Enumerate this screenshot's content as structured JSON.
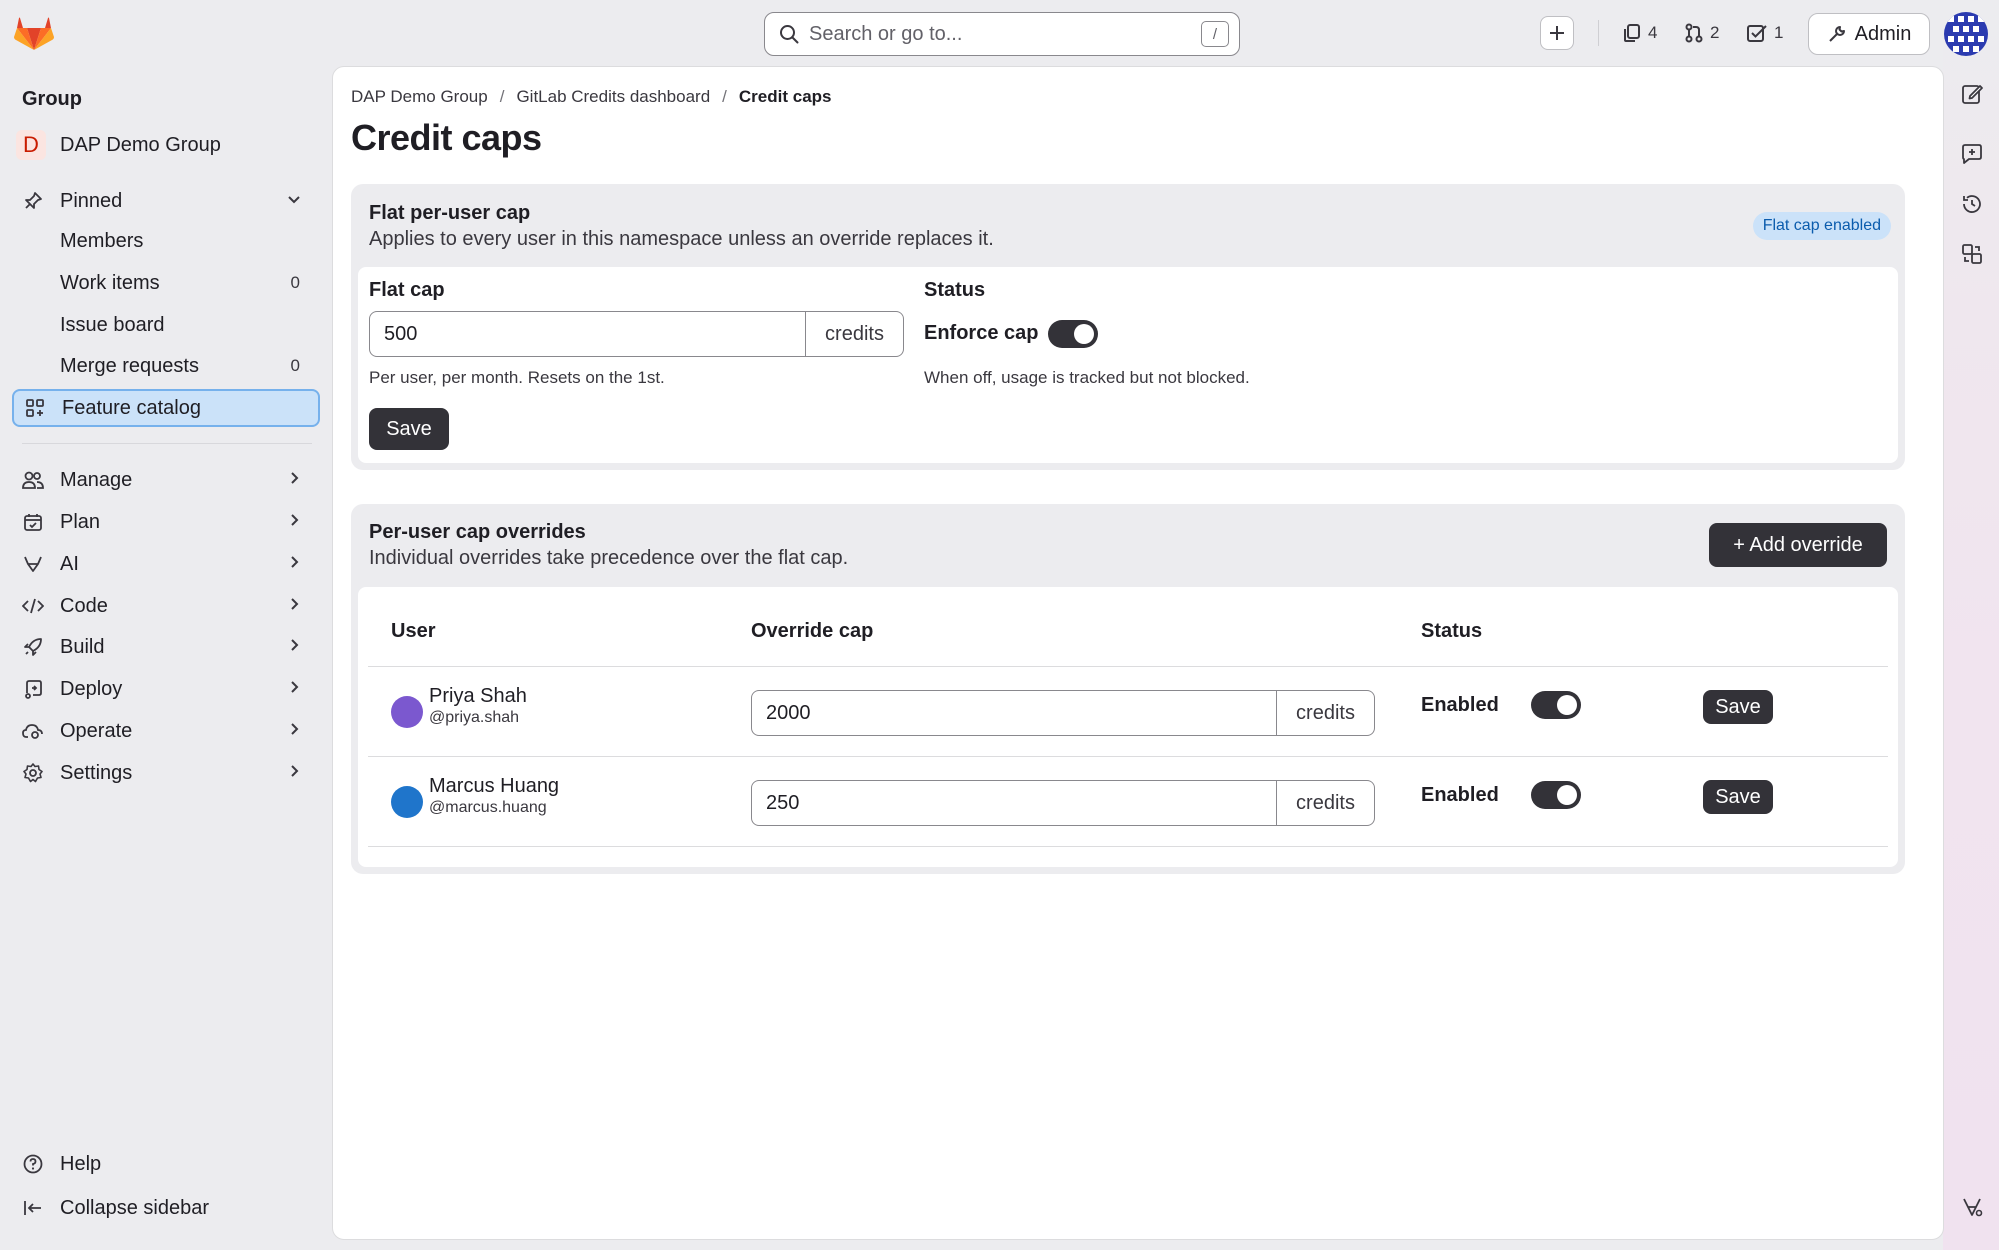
{
  "search": {
    "placeholder": "Search or go to...",
    "shortcut": "/"
  },
  "topbar": {
    "counters": [
      {
        "icon": "issues-icon",
        "value": "4"
      },
      {
        "icon": "merge-request-icon",
        "value": "2"
      },
      {
        "icon": "todo-icon",
        "value": "1"
      }
    ],
    "admin_label": "Admin"
  },
  "sidebar": {
    "heading": "Group",
    "group_initial": "D",
    "group_name": "DAP Demo Group",
    "pinned_label": "Pinned",
    "pinned_items": [
      {
        "label": "Members",
        "count": ""
      },
      {
        "label": "Work items",
        "count": "0"
      },
      {
        "label": "Issue board",
        "count": ""
      },
      {
        "label": "Merge requests",
        "count": "0"
      }
    ],
    "active_item": "Feature catalog",
    "sections": [
      "Manage",
      "Plan",
      "AI",
      "Code",
      "Build",
      "Deploy",
      "Operate",
      "Settings"
    ],
    "help_label": "Help",
    "collapse_label": "Collapse sidebar"
  },
  "breadcrumbs": [
    "DAP Demo Group",
    "GitLab Credits dashboard",
    "Credit caps"
  ],
  "page_title": "Credit caps",
  "flat_cap_card": {
    "title": "Flat per-user cap",
    "subtitle": "Applies to every user in this namespace unless an override replaces it.",
    "badge": "Flat cap enabled",
    "field_label": "Flat cap",
    "value": "500",
    "unit": "credits",
    "help": "Per user, per month. Resets on the 1st.",
    "status_label": "Status",
    "enforce_label": "Enforce cap",
    "enforce_on": true,
    "status_help": "When off, usage is tracked but not blocked.",
    "save_label": "Save"
  },
  "overrides_card": {
    "title": "Per-user cap overrides",
    "subtitle": "Individual overrides take precedence over the flat cap.",
    "add_label": "+ Add override",
    "columns": {
      "user": "User",
      "cap": "Override cap",
      "status": "Status"
    },
    "rows": [
      {
        "name": "Priya Shah",
        "handle": "@priya.shah",
        "avatar_color": "#7b58cf",
        "cap": "2000",
        "unit": "credits",
        "status": "Enabled",
        "enabled": true,
        "save_label": "Save"
      },
      {
        "name": "Marcus Huang",
        "handle": "@marcus.huang",
        "avatar_color": "#1f75cb",
        "cap": "250",
        "unit": "credits",
        "status": "Enabled",
        "enabled": true,
        "save_label": "Save"
      }
    ]
  }
}
